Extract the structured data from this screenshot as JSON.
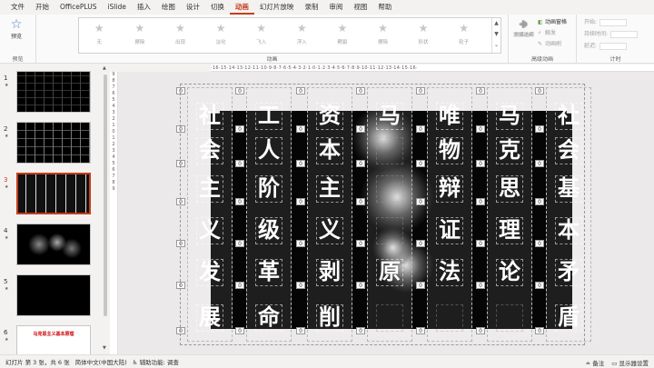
{
  "menu": [
    "文件",
    "开始",
    "OfficePLUS",
    "iSlide",
    "插入",
    "绘图",
    "设计",
    "切换",
    "动画",
    "幻灯片放映",
    "录制",
    "审阅",
    "视图",
    "帮助"
  ],
  "active_menu": "动画",
  "ribbon": {
    "preview_label": "预览",
    "preview_group": "预览",
    "animations": [
      "无",
      "擦除",
      "出现",
      "淡化",
      "飞入",
      "浮入",
      "劈裂",
      "擦除",
      "形状",
      "轮子"
    ],
    "animation_group": "动画",
    "effect_options": "效果选项",
    "add_animation": "添加动画",
    "animation_pane": "动画窗格",
    "trigger": "触发",
    "animation_painter": "动画刷",
    "advanced_group": "高级动画",
    "start": "开始:",
    "duration": "持续时间:",
    "delay": "延迟:",
    "timing_group": "计时"
  },
  "thumbnails": [
    {
      "num": "1",
      "star": "★"
    },
    {
      "num": "2",
      "star": "★"
    },
    {
      "num": "3",
      "star": "★"
    },
    {
      "num": "4",
      "star": "★"
    },
    {
      "num": "5",
      "star": "★"
    },
    {
      "num": "6",
      "star": "★"
    }
  ],
  "thumb6_text": "马克思主义基本原理",
  "ruler_h": "·16·15·14·13·12·11·10·9·8·7·6·5·4·3·2·1·0·1·2·3·4·5·6·7·8·9·10·11·12·13·14·15·16·",
  "ruler_v": [
    "9",
    "8",
    "7",
    "6",
    "5",
    "4",
    "3",
    "2",
    "1",
    "0",
    "1",
    "2",
    "3",
    "4",
    "5",
    "6",
    "7",
    "8",
    "9"
  ],
  "slide_columns": [
    {
      "chars": [
        "社",
        "会",
        "主",
        "义",
        "发",
        "展"
      ]
    },
    {
      "chars": [
        "工",
        "人",
        "阶",
        "级",
        "革",
        "命"
      ]
    },
    {
      "chars": [
        "资",
        "本",
        "主",
        "义",
        "剥",
        "削"
      ]
    },
    {
      "chars": [
        "马",
        "",
        "",
        "",
        "原",
        ""
      ]
    },
    {
      "chars": [
        "唯",
        "物",
        "辩",
        "证",
        "法",
        ""
      ]
    },
    {
      "chars": [
        "马",
        "克",
        "思",
        "理",
        "论",
        ""
      ]
    },
    {
      "chars": [
        "社",
        "会",
        "基",
        "本",
        "矛",
        "盾"
      ]
    }
  ],
  "badge": "0",
  "status": {
    "slide": "幻灯片 第 3 张，共 6 张",
    "lang": "简体中文(中国大陆)",
    "access": "辅助功能: 调查",
    "notes": "备注",
    "display": "显示器设置"
  }
}
